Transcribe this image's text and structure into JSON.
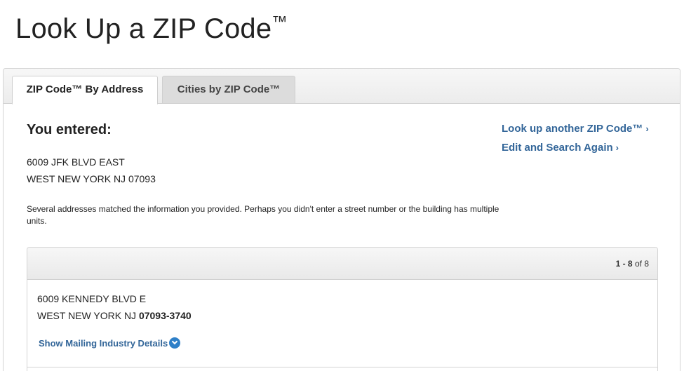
{
  "page": {
    "title": "Look Up a ZIP Code",
    "title_mark": "™"
  },
  "tabs": [
    {
      "label": "ZIP Code™ By Address",
      "active": true
    },
    {
      "label": "Cities by ZIP Code™",
      "active": false
    }
  ],
  "entered": {
    "heading": "You entered:",
    "address_line1": "6009 JFK BLVD EAST",
    "address_line2": "WEST NEW YORK NJ 07093"
  },
  "links": {
    "another": "Look up another ZIP Code™",
    "edit": "Edit and Search Again",
    "chevron": "›"
  },
  "notice": "Several addresses matched the information you provided. Perhaps you didn't enter a street number or the building has multiple units.",
  "results": {
    "range": "1 - 8",
    "of_word": "of",
    "total": "8",
    "items": [
      {
        "line1": "6009 KENNEDY BLVD E",
        "city_state": "WEST NEW YORK NJ",
        "zip": "07093-3740",
        "details_label": "Show Mailing Industry Details"
      }
    ]
  },
  "colors": {
    "link": "#336699",
    "icon_blue": "#2f80c8"
  }
}
